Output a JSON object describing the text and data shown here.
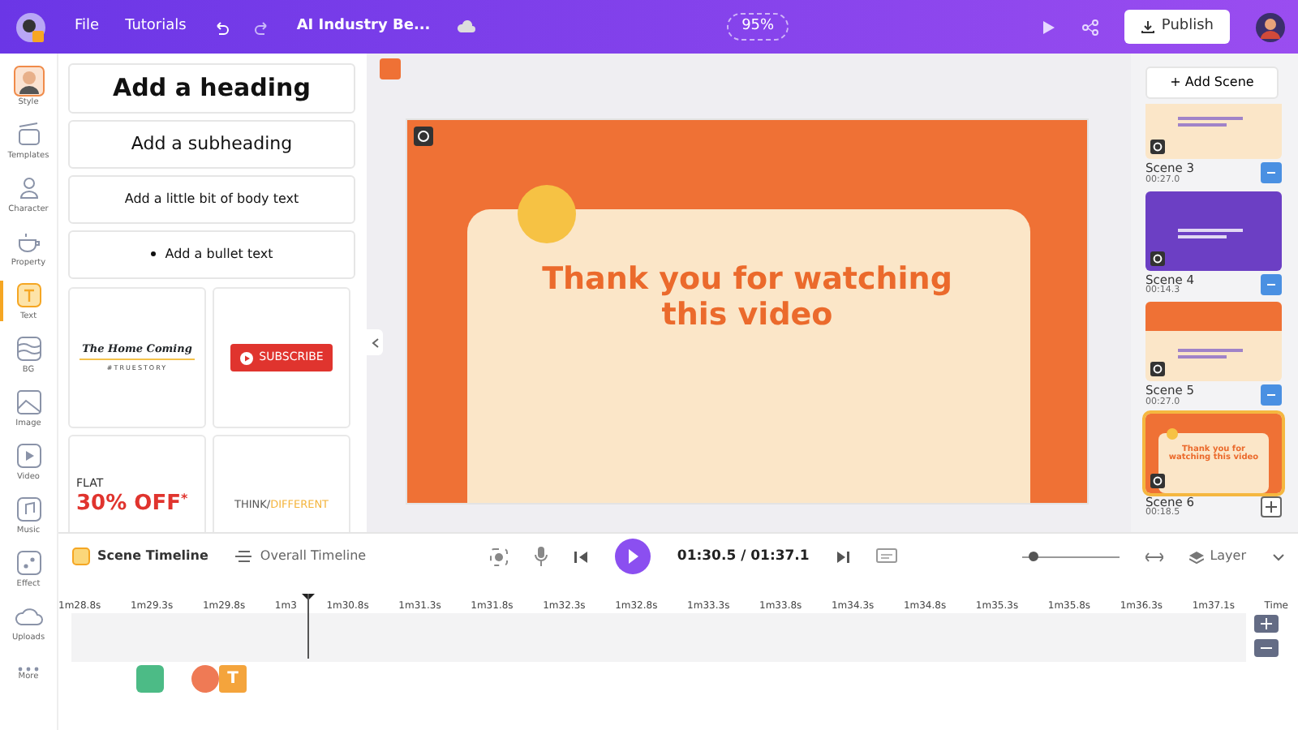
{
  "topbar": {
    "menu": [
      "File",
      "Tutorials"
    ],
    "project_title": "AI Industry Be...",
    "zoom": "95%",
    "publish": "Publish"
  },
  "rail": [
    {
      "label": "Style",
      "selected": false
    },
    {
      "label": "Templates",
      "selected": false
    },
    {
      "label": "Character",
      "selected": false
    },
    {
      "label": "Property",
      "selected": false
    },
    {
      "label": "Text",
      "selected": true
    },
    {
      "label": "BG",
      "selected": false
    },
    {
      "label": "Image",
      "selected": false
    },
    {
      "label": "Video",
      "selected": false
    },
    {
      "label": "Music",
      "selected": false
    },
    {
      "label": "Effect",
      "selected": false
    },
    {
      "label": "Uploads",
      "selected": false
    },
    {
      "label": "More",
      "selected": false
    }
  ],
  "text_panel": {
    "presets": [
      {
        "kind": "heading",
        "text": "Add a heading"
      },
      {
        "kind": "subheading",
        "text": "Add a subheading"
      },
      {
        "kind": "body",
        "text": "Add a little bit of body text"
      },
      {
        "kind": "bullet",
        "text": "Add a bullet text"
      }
    ],
    "templates": [
      {
        "kind": "homecoming",
        "texts": [
          "The Home Coming",
          "#TRUESTORY"
        ]
      },
      {
        "kind": "subscribe",
        "texts": [
          "SUBSCRIBE"
        ]
      },
      {
        "kind": "sale",
        "texts": [
          "FLAT",
          "30% OFF",
          "*"
        ]
      },
      {
        "kind": "think",
        "texts": [
          "THINK/",
          "DIFFERENT"
        ]
      }
    ]
  },
  "canvas": {
    "title": "Thank you for watching this video"
  },
  "scenes": {
    "add_button": "+ Add Scene",
    "items": [
      {
        "name": "Scene 3",
        "time": "00:27.0",
        "selected": false,
        "kind": "cream"
      },
      {
        "name": "Scene 4",
        "time": "00:14.3",
        "selected": false,
        "kind": "purple"
      },
      {
        "name": "Scene 5",
        "time": "00:27.0",
        "selected": false,
        "kind": "orange"
      },
      {
        "name": "Scene 6",
        "time": "00:18.5",
        "selected": true,
        "kind": "thanks",
        "thumb_text": "Thank you for watching this video"
      }
    ]
  },
  "timeline": {
    "tabs": [
      {
        "label": "Scene Timeline",
        "selected": true
      },
      {
        "label": "Overall Timeline",
        "selected": false
      }
    ],
    "time": "01:30.5 / 01:37.1",
    "zoom_slider": {
      "level": 0.12
    },
    "layer": "Layer",
    "ticks": [
      "1m28.8s",
      "1m29.3s",
      "1m29.8s",
      "1m3",
      "1m30.8s",
      "1m31.3s",
      "1m31.8s",
      "1m32.3s",
      "1m32.8s",
      "1m33.3s",
      "1m33.8s",
      "1m34.3s",
      "1m34.8s",
      "1m35.3s",
      "1m35.8s",
      "1m36.3s",
      "1m37.1s"
    ],
    "time_label": "Time",
    "elements": [
      {
        "kind": "square",
        "color": "#4cbb86"
      },
      {
        "kind": "circle",
        "color": "#ef7a55"
      },
      {
        "kind": "text",
        "color": "#f4a43c",
        "text": "T"
      }
    ]
  }
}
